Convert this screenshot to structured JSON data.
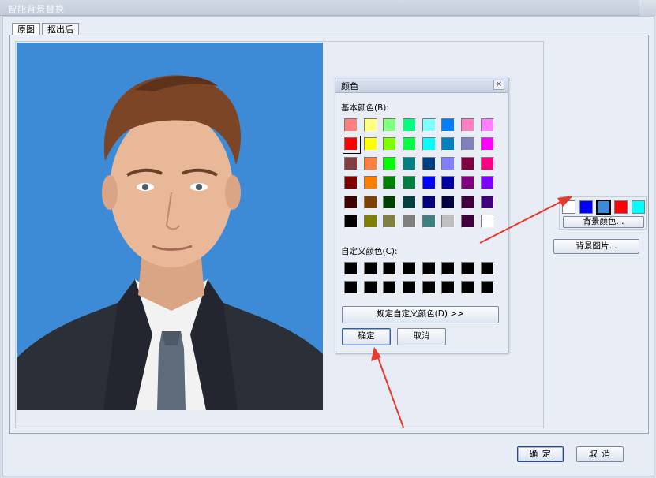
{
  "window": {
    "title": "智能背景替换"
  },
  "tabs": [
    {
      "label": "原图"
    },
    {
      "label": "抠出后"
    }
  ],
  "color_dialog": {
    "title": "颜色",
    "close_glyph": "✕",
    "basic_label": "基本颜色(B):",
    "custom_label": "自定义颜色(C):",
    "define_custom_button": "规定自定义颜色(D) >>",
    "ok_button": "确定",
    "cancel_button": "取消",
    "basic_colors": [
      "#ff8080",
      "#ffff80",
      "#80ff80",
      "#00ff80",
      "#80ffff",
      "#0080ff",
      "#ff80c0",
      "#ff80ff",
      "#ff0000",
      "#ffff00",
      "#80ff00",
      "#00ff40",
      "#00ffff",
      "#0080c0",
      "#8080c0",
      "#ff00ff",
      "#804040",
      "#ff8040",
      "#00ff00",
      "#008080",
      "#004080",
      "#8080ff",
      "#800040",
      "#ff0080",
      "#800000",
      "#ff8000",
      "#008000",
      "#008040",
      "#0000ff",
      "#0000a0",
      "#800080",
      "#8000ff",
      "#400000",
      "#804000",
      "#004000",
      "#004040",
      "#000080",
      "#000040",
      "#400040",
      "#400080",
      "#000000",
      "#808000",
      "#808040",
      "#808080",
      "#408080",
      "#c0c0c0",
      "#400040",
      "#ffffff"
    ],
    "selected_index": 8,
    "custom_colors": [
      "#000000",
      "#000000",
      "#000000",
      "#000000",
      "#000000",
      "#000000",
      "#000000",
      "#000000",
      "#000000",
      "#000000",
      "#000000",
      "#000000",
      "#000000",
      "#000000",
      "#000000",
      "#000000"
    ]
  },
  "background_panel": {
    "swatches": [
      "#ffffff",
      "#0000ff",
      "#3d8ad6",
      "#ff0000",
      "#00ffff"
    ],
    "selected_index": 2,
    "bg_color_button": "背景颜色...",
    "bg_image_button": "背景图片..."
  },
  "footer": {
    "ok_button": "确  定",
    "cancel_button": "取  消"
  },
  "colors": {
    "photo_background": "#3d8ad6",
    "annotation_arrow": "#e8392e"
  }
}
